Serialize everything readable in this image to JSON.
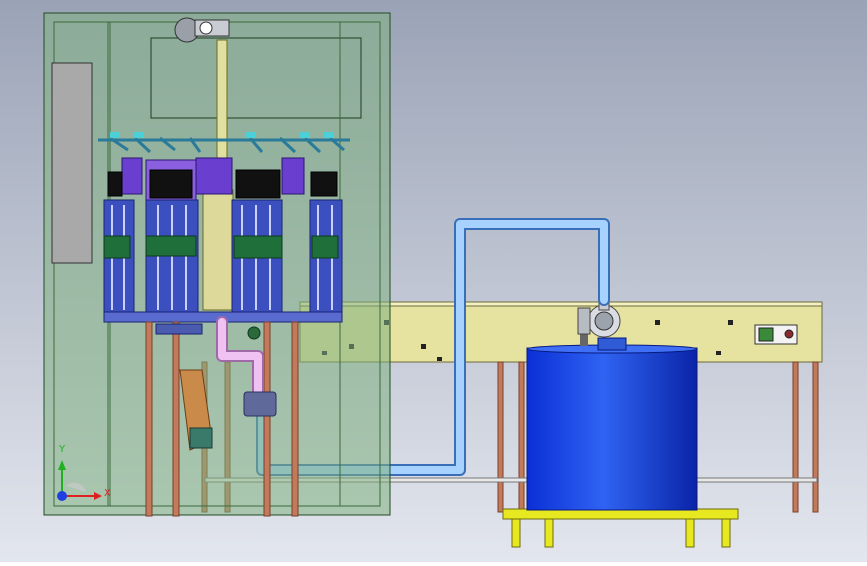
{
  "viewport": {
    "background_top": "#9aa3b6",
    "background_bottom": "#e3e6ee"
  },
  "triad": {
    "x_label": "X",
    "y_label": "Y",
    "x_color": "#e02020",
    "y_color": "#20b020",
    "z_color": "#2040e0"
  },
  "model": {
    "frame_color": "#7fb07f",
    "table_color": "#e6e3a0",
    "tank_color": "#1f4be0",
    "pipe_color": "#8ec0ef",
    "leg_color": "#c27a5a",
    "stand_color": "#e8e820"
  },
  "control_box": {
    "color": "#3a8a3a"
  }
}
